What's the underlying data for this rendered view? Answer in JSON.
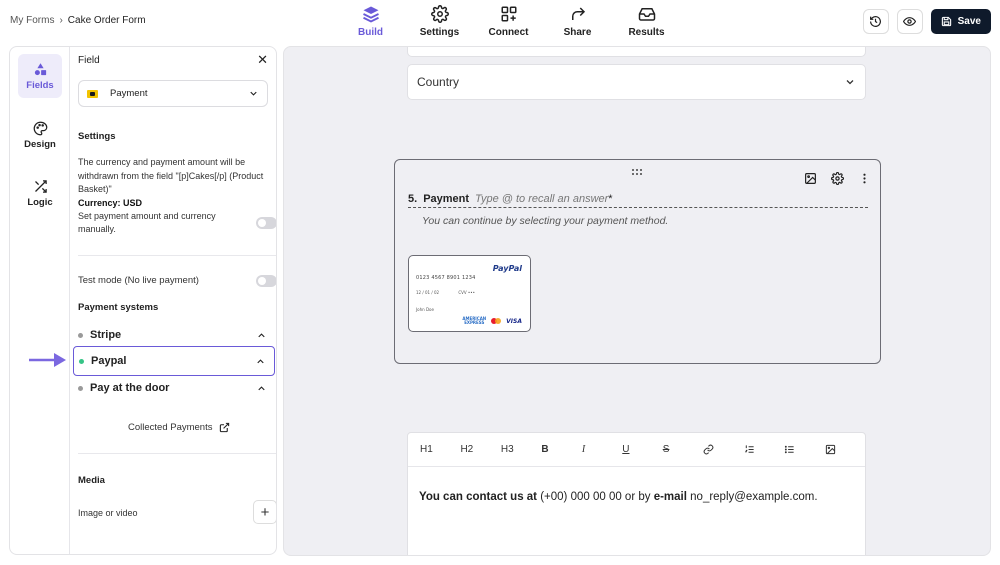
{
  "breadcrumb": {
    "root": "My Forms",
    "current": "Cake Order Form"
  },
  "nav": {
    "tabs": [
      {
        "label": "Build",
        "icon": "layers-icon",
        "active": true
      },
      {
        "label": "Settings",
        "icon": "gear-icon"
      },
      {
        "label": "Connect",
        "icon": "connect-icon"
      },
      {
        "label": "Share",
        "icon": "share-icon"
      },
      {
        "label": "Results",
        "icon": "inbox-icon"
      }
    ]
  },
  "toolbar": {
    "save_label": "Save"
  },
  "rail": [
    {
      "label": "Fields",
      "icon": "fields-icon",
      "active": true
    },
    {
      "label": "Design",
      "icon": "palette-icon"
    },
    {
      "label": "Logic",
      "icon": "shuffle-icon"
    }
  ],
  "field_panel": {
    "header": "Field",
    "selected_field": "Payment",
    "settings_title": "Settings",
    "description_line": "The currency and payment amount will be withdrawn from the field \"[p]Cakes[/p] (Product Basket)\"",
    "currency_label": "Currency: USD",
    "manual_label": "Set payment amount and currency manually.",
    "test_mode_label": "Test mode (No live payment)",
    "payment_systems_title": "Payment systems",
    "payment_systems": [
      {
        "label": "Stripe",
        "status": "inactive"
      },
      {
        "label": "Paypal",
        "status": "active",
        "selected": true
      },
      {
        "label": "Pay at the door",
        "status": "inactive"
      }
    ],
    "collected_payments": "Collected Payments",
    "media_title": "Media",
    "image_or_video": "Image or video"
  },
  "canvas": {
    "country_placeholder": "Country",
    "payment_question": {
      "number": "5.",
      "title": "Payment",
      "placeholder": "Type @ to recall an answer",
      "required_mark": "*",
      "description": "You can continue by selecting your payment method."
    },
    "card": {
      "brand": "PayPal",
      "number": "0123 4567 8901 1234",
      "expiry": "12 / 01 / 02",
      "cvv": "CVV •••",
      "name": "John Doe",
      "logos": [
        "AMERICAN EXPRESS",
        "mastercard",
        "VISA"
      ]
    },
    "editor": {
      "tools": [
        "H1",
        "H2",
        "H3",
        "B",
        "I",
        "U",
        "S",
        "link",
        "ordered-list",
        "bullet-list",
        "image"
      ],
      "text_parts": {
        "bold1": "You can contact us at",
        "plain1": " (+00) 000 00 00 or by ",
        "bold2": "e-mail",
        "plain2": " no_reply@example.com."
      }
    }
  },
  "colors": {
    "accent": "#6a5ad8",
    "save_bg": "#0f1a2b",
    "active_dot": "#35c486"
  }
}
